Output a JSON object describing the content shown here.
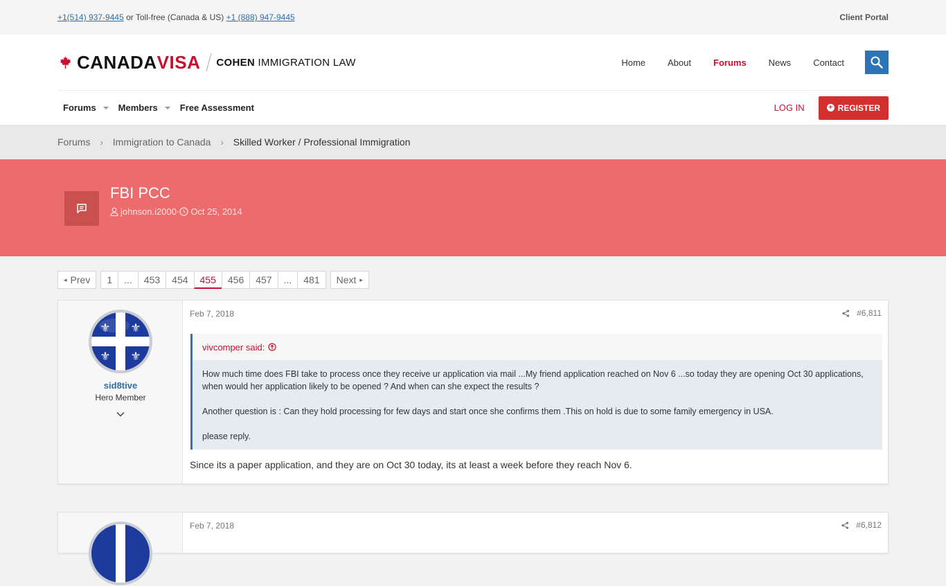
{
  "topbar": {
    "phone1": "+1(514) 937-9445",
    "middle": " or Toll-free (Canada & US) ",
    "phone2": "+1 (888) 947-9445",
    "client_portal": "Client Portal"
  },
  "logo": {
    "canada": "CANADA",
    "visa": "VISA",
    "cohen": "COHEN",
    "immigration_law": " IMMIGRATION LAW"
  },
  "mainnav": [
    "Home",
    "About",
    "Forums",
    "News",
    "Contact"
  ],
  "subnav": {
    "forums": "Forums",
    "members": "Members",
    "free_assessment": "Free Assessment",
    "login": "LOG IN",
    "register": "REGISTER"
  },
  "breadcrumb": [
    "Forums",
    "Immigration to Canada",
    "Skilled Worker / Professional Immigration"
  ],
  "thread": {
    "title": "FBI PCC",
    "author": "johnson.i2000",
    "sep": " · ",
    "date": "Oct 25, 2014"
  },
  "pager": {
    "prev": "Prev",
    "next": "Next",
    "pages": [
      "1",
      "...",
      "453",
      "454",
      "455",
      "456",
      "457",
      "...",
      "481"
    ],
    "current": "455"
  },
  "posts": [
    {
      "username": "sid8tive",
      "user_title": "Hero Member",
      "date": "Feb 7, 2018",
      "number": "#6,811",
      "quote_author": "vivcomper said:",
      "quote_paragraphs": [
        "How much time does FBI take to process once they receive ur application via mail ...My friend application reached on Nov 6 ...so today they are opening Oct 30 applications, when would her application likely to be opened ? And when can she expect the results ?",
        "Another question is : Can they hold processing for few days and start once she confirms them .This on hold is due to some family emergency in USA.",
        "please reply."
      ],
      "reply": "Since its a paper application, and they are on Oct 30 today, its at least a week before they reach Nov 6."
    },
    {
      "date": "Feb 7, 2018",
      "number": "#6,812"
    }
  ],
  "colors": {
    "brand_red": "#c8102e",
    "hero": "#ec6b6c",
    "link_blue": "#2e6fa7",
    "search_blue": "#2e74b5"
  },
  "icons": [
    "maple-leaf-icon",
    "search-icon",
    "thread-icon",
    "user-icon",
    "clock-icon",
    "share-icon",
    "arrow-up-circle-icon",
    "chevron-down-icon"
  ]
}
